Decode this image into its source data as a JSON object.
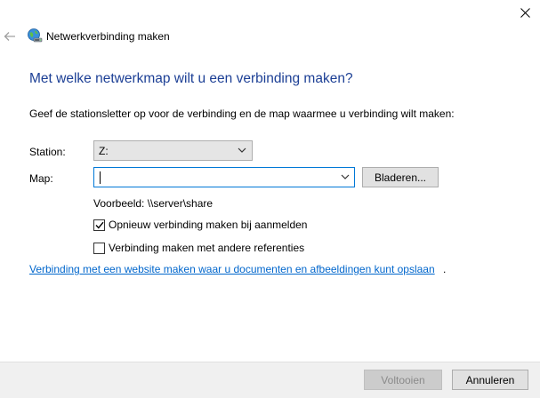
{
  "window": {
    "title": "Netwerkverbinding maken",
    "close_icon": "close-icon",
    "back_icon": "back-arrow-icon",
    "app_icon": "network-drive-icon"
  },
  "main": {
    "instruction": "Met welke netwerkmap wilt u een verbinding maken?",
    "description": "Geef de stationsletter op voor de verbinding en de map waarmee u verbinding wilt maken:"
  },
  "form": {
    "station_label": "Station:",
    "station_value": "Z:",
    "map_label": "Map:",
    "map_value": "",
    "browse_label": "Bladeren...",
    "example": "Voorbeeld: \\\\server\\share"
  },
  "options": {
    "reconnect_label": "Opnieuw verbinding maken bij aanmelden",
    "reconnect_checked": true,
    "other_credentials_label": "Verbinding maken met andere referenties",
    "other_credentials_checked": false
  },
  "link": {
    "text": "Verbinding met een website maken waar u documenten en afbeeldingen kunt opslaan",
    "suffix": "."
  },
  "footer": {
    "finish_label": "Voltooien",
    "finish_enabled": false,
    "cancel_label": "Annuleren"
  },
  "colors": {
    "instruction": "#1c3f95",
    "link": "#0066cc",
    "focus_border": "#0078d7"
  }
}
